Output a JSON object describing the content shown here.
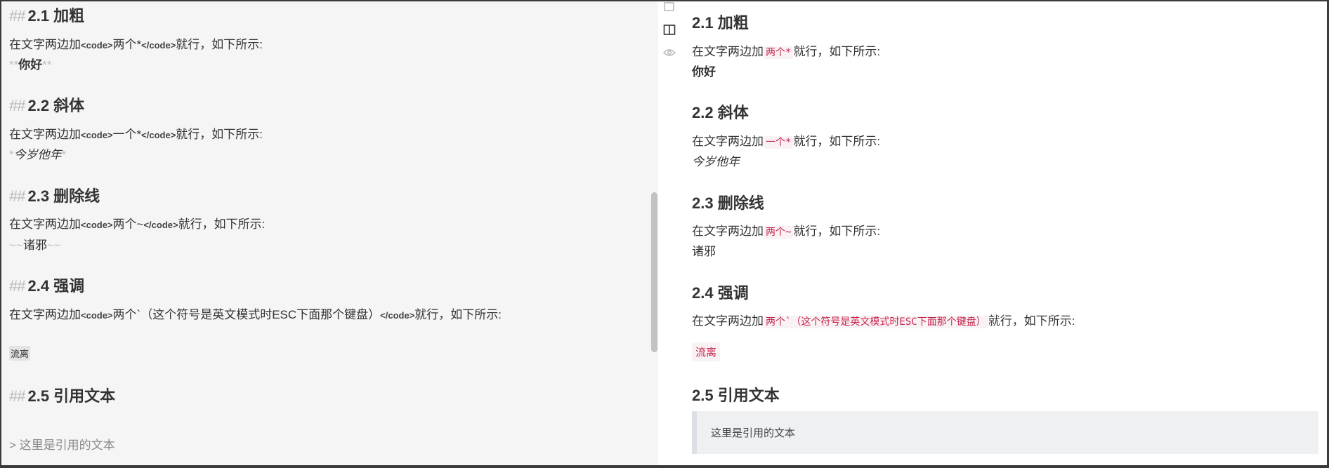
{
  "editor": {
    "heading_marker": "##",
    "sections": [
      {
        "heading": "2.1 加粗",
        "desc_pre": "在文字两边加",
        "code_open": "<code>",
        "code_text": "两个*",
        "code_close": "</code>",
        "desc_post": "就行，如下所示:",
        "sample_fmt": "**",
        "sample_text": "你好"
      },
      {
        "heading": "2.2 斜体",
        "desc_pre": "在文字两边加",
        "code_open": "<code>",
        "code_text": "一个*",
        "code_close": "</code>",
        "desc_post": "就行，如下所示:",
        "sample_fmt": "*",
        "sample_text": "今岁他年"
      },
      {
        "heading": "2.3 删除线",
        "desc_pre": "在文字两边加",
        "code_open": "<code>",
        "code_text": "两个~",
        "code_close": "</code>",
        "desc_post": "就行，如下所示:",
        "sample_fmt": "~~",
        "sample_text": "诸邪"
      },
      {
        "heading": "2.4 强调",
        "desc_pre": "在文字两边加",
        "code_open": "<code>",
        "code_text": "两个`（这个符号是英文模式时ESC下面那个键盘）",
        "code_close": "</code>",
        "desc_post": "就行，如下所示:",
        "sample_text": "流离"
      },
      {
        "heading": "2.5 引用文本",
        "quote_marker": ">",
        "sample_text": "这里是引用的文本"
      }
    ]
  },
  "modebar": {
    "icons": [
      "editor-only-icon",
      "split-view-icon",
      "preview-eye-icon"
    ]
  },
  "preview": {
    "sections": [
      {
        "heading": "2.1 加粗",
        "desc_pre": "在文字两边加",
        "code": "两个*",
        "desc_post": "就行，如下所示:",
        "sample": "你好"
      },
      {
        "heading": "2.2 斜体",
        "desc_pre": "在文字两边加",
        "code": "一个*",
        "desc_post": "就行，如下所示:",
        "sample": "今岁他年"
      },
      {
        "heading": "2.3 删除线",
        "desc_pre": "在文字两边加",
        "code": "两个~",
        "desc_post": "就行，如下所示:",
        "sample": "诸邪"
      },
      {
        "heading": "2.4 强调",
        "desc_pre": "在文字两边加",
        "code": "两个`（这个符号是英文模式时ESC下面那个键盘）",
        "desc_post": "就行，如下所示:",
        "sample": "流离"
      },
      {
        "heading": "2.5 引用文本",
        "quote": "这里是引用的文本"
      }
    ]
  },
  "colors": {
    "editor_bg": "#f5f5f6",
    "code_fg": "#c7254e",
    "code_bg": "#f9f2f4",
    "blockquote_bg": "#eef0f2"
  }
}
